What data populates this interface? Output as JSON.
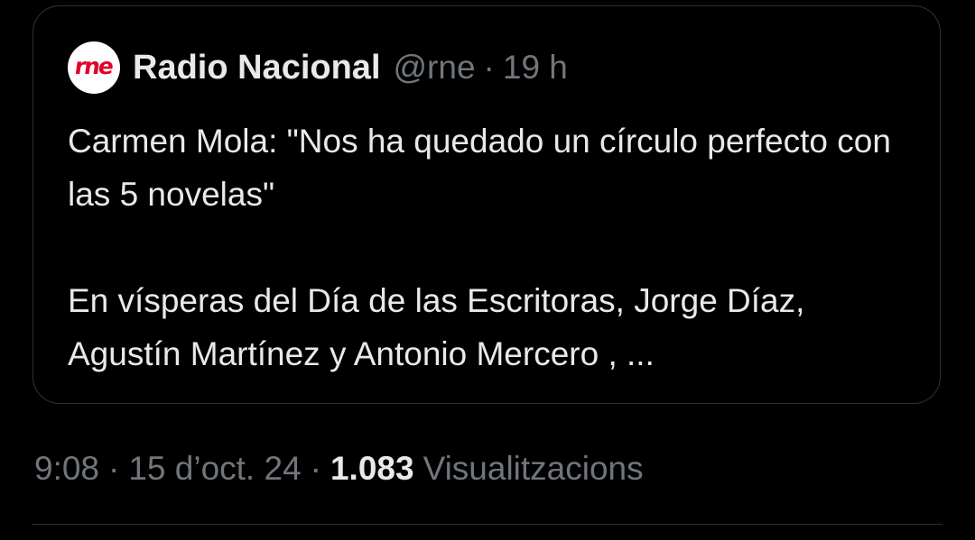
{
  "quoted_post": {
    "avatar_logo": "rne",
    "display_name": "Radio Nacional",
    "handle": "@rne",
    "separator": "·",
    "time_ago": "19 h",
    "paragraphs": [
      "Carmen Mola: \"Nos ha quedado un círculo perfecto con las 5 novelas\"",
      "En vísperas del Día de las Escritoras, Jorge Díaz, Agustín Martínez y Antonio Mercero , ..."
    ]
  },
  "post_meta": {
    "time": "9:08",
    "date": "15 d’oct. 24",
    "separator": "·",
    "view_count": "1.083",
    "views_label": "Visualitzacions"
  },
  "colors": {
    "background": "#000000",
    "border": "#2f3336",
    "primary_text": "#e7e9ea",
    "secondary_text": "#71767b",
    "brand_red": "#e4002b"
  }
}
